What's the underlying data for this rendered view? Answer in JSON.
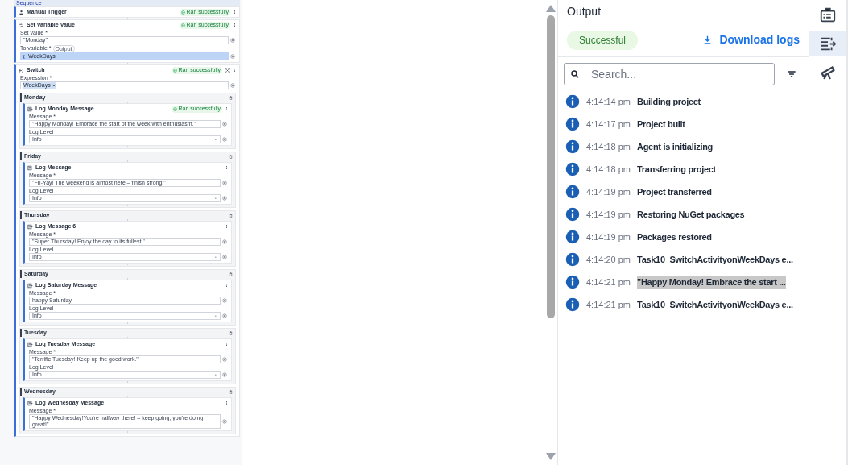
{
  "canvas": {
    "label": "Sequence",
    "activities": [
      {
        "kind": "trigger",
        "title": "Manual Trigger",
        "status": "Ran successfully"
      },
      {
        "kind": "set_variable",
        "title": "Set Variable Value",
        "status": "Ran successfully",
        "value_label": "Set value *",
        "value": "\"Monday\"",
        "to_label": "To variable *",
        "to_tag": "Output",
        "variable": "WeekDays"
      },
      {
        "kind": "switch",
        "title": "Switch",
        "status": "Ran successfully",
        "expression_label": "Expression *",
        "expression_token": "WeekDays",
        "cases": [
          {
            "label": "Monday",
            "activity": {
              "title": "Log Monday Message",
              "status": "Ran successfully",
              "message_label": "Message *",
              "message": "\"Happy Monday! Embrace the start of the week with enthusiasm.\"",
              "level_label": "Log Level",
              "level": "Info"
            }
          },
          {
            "label": "Friday",
            "activity": {
              "title": "Log Message",
              "message_label": "Message *",
              "message": "\"Fri-Yay! The weekend is almost here – finish strong!\"",
              "level_label": "Log Level",
              "level": "Info"
            }
          },
          {
            "label": "Thursday",
            "activity": {
              "title": "Log Message 6",
              "message_label": "Message *",
              "message": "\"Super Thursday! Enjoy the day to its fullest.\"",
              "level_label": "Log Level",
              "level": "Info"
            }
          },
          {
            "label": "Saturday",
            "activity": {
              "title": "Log Saturday Message",
              "message_label": "Message *",
              "message": "happy Saturday",
              "level_label": "Log Level",
              "level": "Info"
            }
          },
          {
            "label": "Tuesday",
            "activity": {
              "title": "Log Tuesday Message",
              "message_label": "Message *",
              "message": "\"Terrific Tuesday! Keep up the good work.\"",
              "level_label": "Log Level",
              "level": "Info"
            }
          },
          {
            "label": "Wednesday",
            "activity": {
              "title": "Log Wednesday Message",
              "message_label": "Message *",
              "message": "\"Happy Wednesday!You're halfway there! – keep going, you're doing great!\""
            }
          }
        ]
      }
    ]
  },
  "output": {
    "title": "Output",
    "status": "Successful",
    "download": "Download logs",
    "search": {
      "placeholder": "Search..."
    },
    "logs": [
      {
        "time": "4:14:14 pm",
        "text": "Building project",
        "selected": false
      },
      {
        "time": "4:14:17 pm",
        "text": "Project built",
        "selected": false
      },
      {
        "time": "4:14:18 pm",
        "text": "Agent is initializing",
        "selected": false
      },
      {
        "time": "4:14:18 pm",
        "text": "Transferring project",
        "selected": false
      },
      {
        "time": "4:14:19 pm",
        "text": "Project transferred",
        "selected": false
      },
      {
        "time": "4:14:19 pm",
        "text": "Restoring NuGet packages",
        "selected": false
      },
      {
        "time": "4:14:19 pm",
        "text": "Packages restored",
        "selected": false
      },
      {
        "time": "4:14:20 pm",
        "text": "Task10_SwitchActivityonWeekDays e...",
        "selected": false
      },
      {
        "time": "4:14:21 pm",
        "text": "\"Happy Monday! Embrace the start ...",
        "selected": true
      },
      {
        "time": "4:14:21 pm",
        "text": "Task10_SwitchActivityonWeekDays e...",
        "selected": false
      }
    ]
  },
  "rail": [
    {
      "kind": "briefcase",
      "selected": false
    },
    {
      "kind": "output",
      "selected": true
    },
    {
      "kind": "telescope",
      "selected": false
    }
  ]
}
